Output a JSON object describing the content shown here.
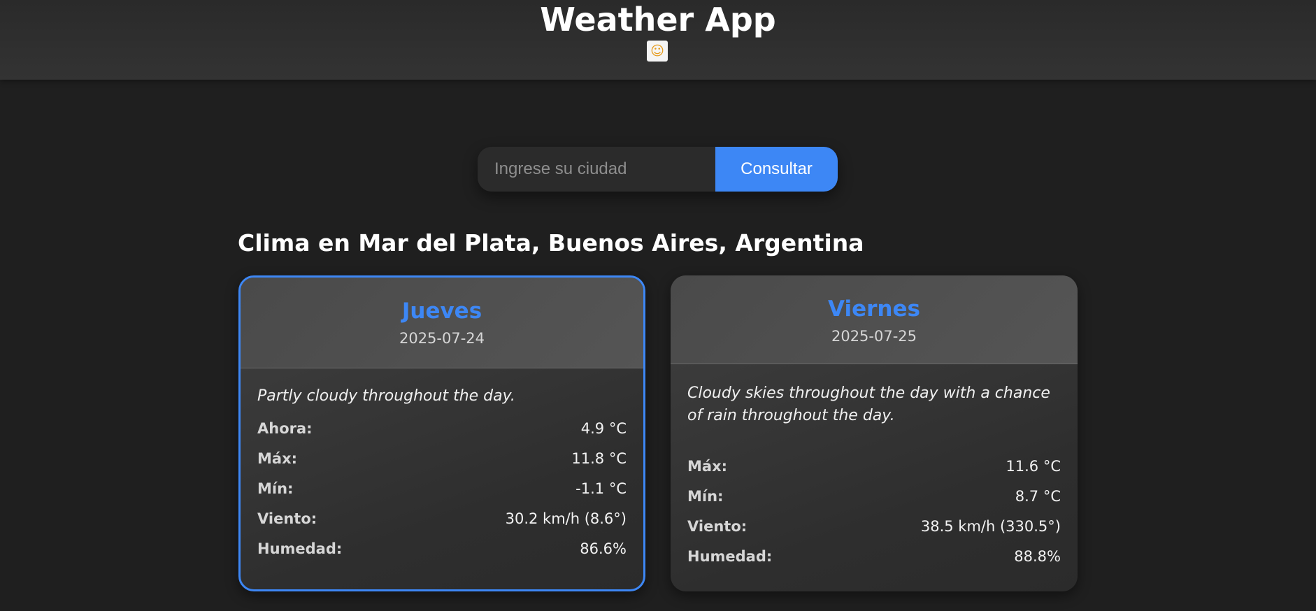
{
  "header": {
    "title": "Weather App",
    "logo_icon": "sun-smiley-emoji"
  },
  "search": {
    "placeholder": "Ingrese su ciudad",
    "value": "",
    "button_label": "Consultar"
  },
  "location": {
    "title": "Clima en Mar del Plata, Buenos Aires, Argentina"
  },
  "forecast": [
    {
      "day": "Jueves",
      "date": "2025-07-24",
      "selected": true,
      "description": "Partly cloudy throughout the day.",
      "rows": [
        {
          "label": "Ahora:",
          "value": "4.9 °C"
        },
        {
          "label": "Máx:",
          "value": "11.8 °C"
        },
        {
          "label": "Mín:",
          "value": "-1.1 °C"
        },
        {
          "label": "Viento:",
          "value": "30.2 km/h (8.6°)"
        },
        {
          "label": "Humedad:",
          "value": "86.6%"
        }
      ]
    },
    {
      "day": "Viernes",
      "date": "2025-07-25",
      "selected": false,
      "description": "Cloudy skies throughout the day with a chance of rain throughout the day.",
      "rows": [
        {
          "label": "Máx:",
          "value": "11.6 °C"
        },
        {
          "label": "Mín:",
          "value": "8.7 °C"
        },
        {
          "label": "Viento:",
          "value": "38.5 km/h (330.5°)"
        },
        {
          "label": "Humedad:",
          "value": "88.8%"
        }
      ]
    }
  ],
  "colors": {
    "accent": "#3d87f5",
    "background": "#1f1f1f",
    "card": "#333333"
  }
}
